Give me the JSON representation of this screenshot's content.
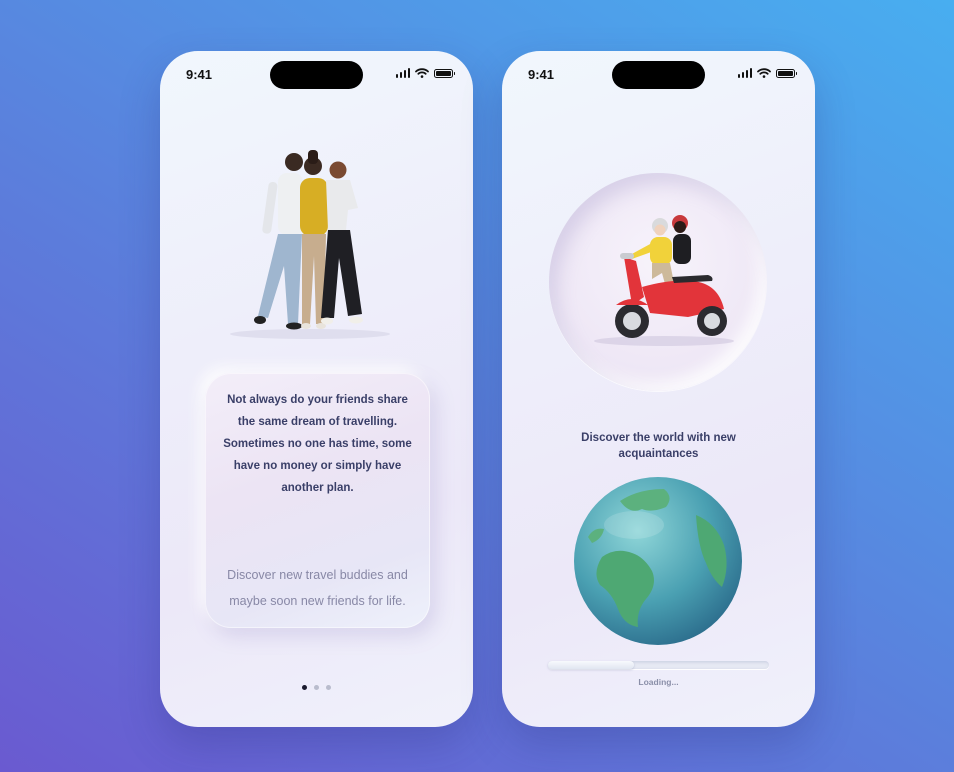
{
  "screens": [
    {
      "status_time": "9:41",
      "headline": "Not always do your friends share the same dream of travelling. Sometimes no one has time, some have no money or simply have another plan.",
      "subtext": "Discover new travel buddies and maybe soon new friends for life.",
      "pagination": {
        "current": 1,
        "total": 3
      }
    },
    {
      "status_time": "9:41",
      "discover_text": "Discover the world with new acquaintances",
      "loading_text": "Loading...",
      "progress": 0.39
    }
  ],
  "icons": [
    "signal-icon",
    "wifi-icon",
    "battery-icon"
  ],
  "colors": {
    "background_start": "#6a5ad0",
    "background_end": "#48aef0",
    "text_dark": "#3a3f68",
    "text_muted": "#8888a6",
    "scooter_red": "#e2343a"
  }
}
